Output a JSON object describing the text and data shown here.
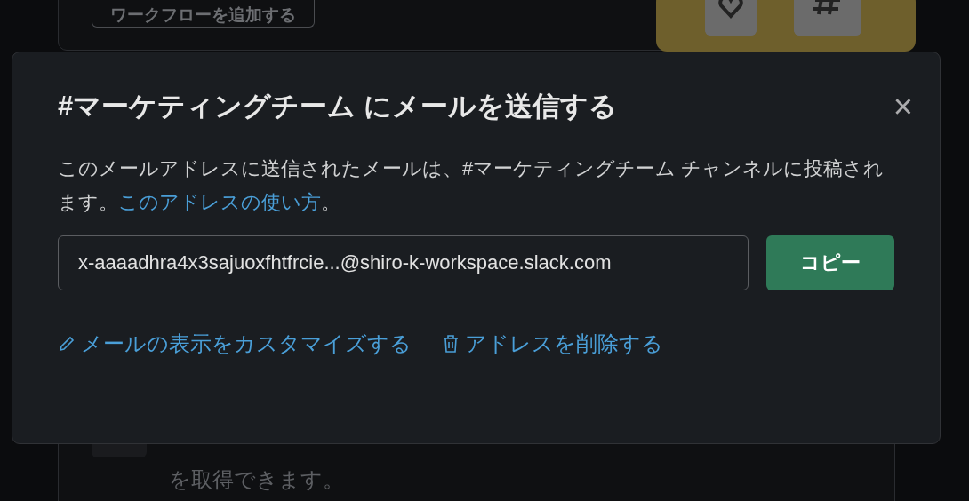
{
  "background": {
    "workflow_button": "ワークフローを追加する",
    "description_tail": "を取得できます。"
  },
  "dialog": {
    "title": "#マーケティングチーム にメールを送信する",
    "close": "×",
    "description": "このメールアドレスに送信されたメールは、#マーケティングチーム チャンネルに投稿されます。",
    "help_link": "このアドレスの使い方",
    "after_link": "。",
    "email": "x-aaaadhra4x3sajuoxfhtfrcie...@shiro-k-workspace.slack.com",
    "copy_button": "コピー",
    "actions": [
      {
        "kind": "edit",
        "label": "メールの表示をカスタマイズする"
      },
      {
        "kind": "delete",
        "label": "アドレスを削除する"
      }
    ]
  }
}
